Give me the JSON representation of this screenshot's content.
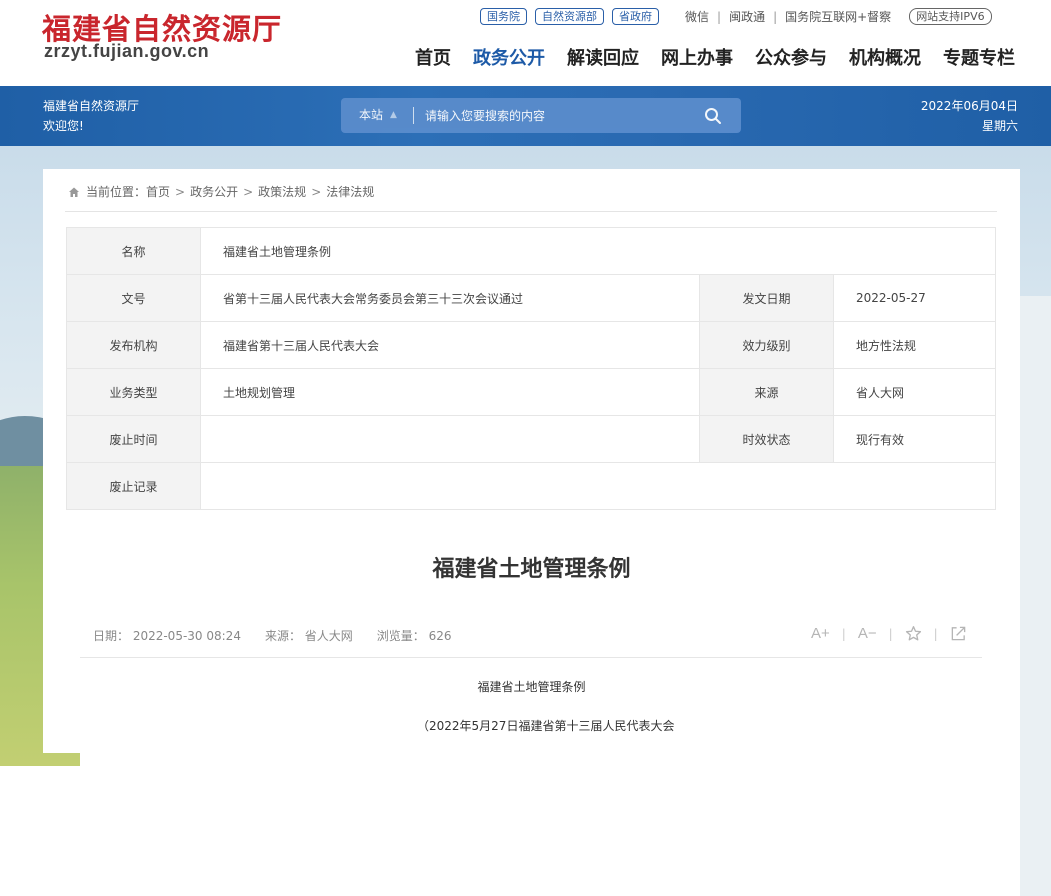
{
  "header": {
    "logo_cn": "福建省自然资源厅",
    "logo_en": "zrzyt.fujian.gov.cn",
    "top_pills": [
      "国务院",
      "自然资源部",
      "省政府"
    ],
    "top_links": [
      "微信",
      "闽政通",
      "国务院互联网+督察"
    ],
    "ipv6": "网站支持IPV6",
    "nav": [
      "首页",
      "政务公开",
      "解读回应",
      "网上办事",
      "公众参与",
      "机构概况",
      "专题专栏"
    ],
    "nav_active": "政务公开"
  },
  "bar": {
    "welcome_line1": "福建省自然资源厅",
    "welcome_line2": "欢迎您!",
    "search_scope": "本站",
    "search_placeholder": "请输入您要搜索的内容",
    "date": "2022年06月04日",
    "weekday": "星期六"
  },
  "breadcrumb": {
    "prefix": "当前位置：",
    "items": [
      "首页",
      "政务公开",
      "政策法规",
      "法律法规"
    ]
  },
  "meta": {
    "name_label": "名称",
    "name_value": "福建省土地管理条例",
    "doc_label": "文号",
    "doc_value": "省第十三届人民代表大会常务委员会第三十三次会议通过",
    "issue_date_label": "发文日期",
    "issue_date_value": "2022-05-27",
    "org_label": "发布机构",
    "org_value": "福建省第十三届人民代表大会",
    "level_label": "效力级别",
    "level_value": "地方性法规",
    "type_label": "业务类型",
    "type_value": "土地规划管理",
    "source_label": "来源",
    "source_value": "省人大网",
    "abolish_time_label": "废止时间",
    "abolish_time_value": "",
    "status_label": "时效状态",
    "status_value": "现行有效",
    "abolish_record_label": "废止记录",
    "abolish_record_value": ""
  },
  "article": {
    "title": "福建省土地管理条例",
    "date": "日期：  2022-05-30 08:24",
    "source": "来源：  省人大网",
    "views": "浏览量：  626",
    "tool_font_up": "A+",
    "tool_font_down": "A−",
    "body_title": "福建省土地管理条例",
    "body_line2": "（2022年5月27日福建省第十三届人民代表大会"
  }
}
